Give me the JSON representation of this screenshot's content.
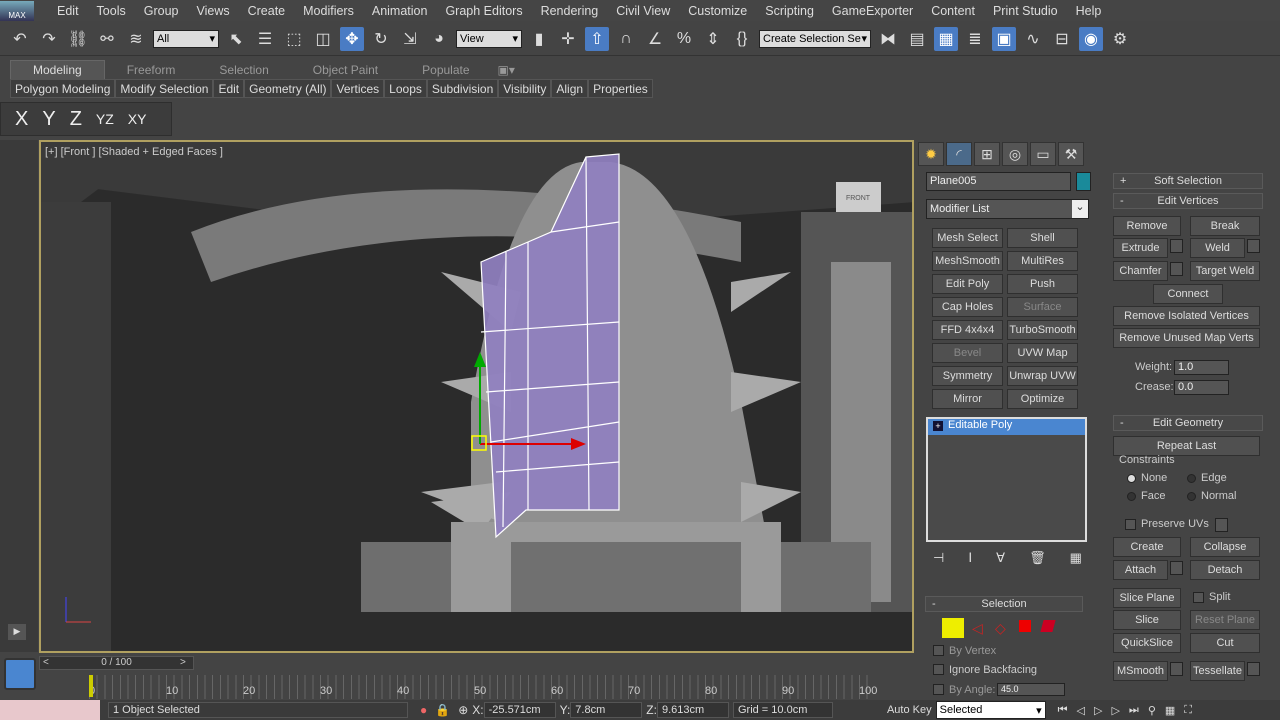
{
  "menubar": {
    "logo": "MAX",
    "items": [
      "Edit",
      "Tools",
      "Group",
      "Views",
      "Create",
      "Modifiers",
      "Animation",
      "Graph Editors",
      "Rendering",
      "Civil View",
      "Customize",
      "Scripting",
      "GameExporter",
      "Content",
      "Print Studio",
      "Help"
    ]
  },
  "toolbar": {
    "selection_filter": "All",
    "reference_coord": "View",
    "named_selection": "Create Selection Se"
  },
  "ribbon": {
    "tabs": [
      "Modeling",
      "Freeform",
      "Selection",
      "Object Paint",
      "Populate"
    ],
    "active_tab": "Modeling",
    "panels": [
      "Polygon Modeling",
      "Modify Selection",
      "Edit",
      "Geometry (All)",
      "Vertices",
      "Loops",
      "Subdivision",
      "Visibility",
      "Align",
      "Properties"
    ]
  },
  "axis_constraints": [
    "X",
    "Y",
    "Z",
    "YZ",
    "XY"
  ],
  "viewport": {
    "label": "[+] [Front ] [Shaded + Edged Faces ]",
    "viewcube": "FRONT"
  },
  "command_panel": {
    "object_name": "Plane005",
    "object_color": "#1a8a9a",
    "modifier_list": "Modifier List",
    "modifier_buttons": [
      [
        "Mesh Select",
        "Shell"
      ],
      [
        "MeshSmooth",
        "MultiRes"
      ],
      [
        "Edit Poly",
        "Push"
      ],
      [
        "Cap Holes",
        "Surface"
      ],
      [
        "FFD 4x4x4",
        "TurboSmooth"
      ],
      [
        "Bevel",
        "UVW Map"
      ],
      [
        "Symmetry",
        "Unwrap UVW"
      ],
      [
        "Mirror",
        "Optimize"
      ]
    ],
    "stack": [
      "Editable Poly"
    ],
    "selection": {
      "title": "Selection",
      "by_vertex": "By Vertex",
      "ignore_backfacing": "Ignore Backfacing",
      "by_angle": "By Angle:",
      "angle": "45.0"
    },
    "soft_selection": "Soft Selection",
    "edit_vertices": {
      "title": "Edit Vertices",
      "remove": "Remove",
      "break": "Break",
      "extrude": "Extrude",
      "weld": "Weld",
      "chamfer": "Chamfer",
      "target_weld": "Target Weld",
      "connect": "Connect",
      "remove_isolated": "Remove Isolated Vertices",
      "remove_unused": "Remove Unused Map Verts",
      "weight_label": "Weight:",
      "weight": "1.0",
      "crease_label": "Crease:",
      "crease": "0.0"
    },
    "edit_geometry": {
      "title": "Edit Geometry",
      "repeat_last": "Repeat Last",
      "constraints": "Constraints",
      "none": "None",
      "edge": "Edge",
      "face": "Face",
      "normal": "Normal",
      "preserve_uvs": "Preserve UVs",
      "create": "Create",
      "collapse": "Collapse",
      "attach": "Attach",
      "detach": "Detach",
      "slice_plane": "Slice Plane",
      "split": "Split",
      "slice": "Slice",
      "reset_plane": "Reset Plane",
      "quickslice": "QuickSlice",
      "cut": "Cut",
      "msmooth": "MSmooth",
      "tessellate": "Tessellate"
    }
  },
  "timeline": {
    "frame": "0 / 100",
    "ticks": [
      "0",
      "10",
      "20",
      "30",
      "40",
      "50",
      "60",
      "70",
      "80",
      "90",
      "100"
    ]
  },
  "status": {
    "selected": "1 Object Selected",
    "x_label": "X:",
    "x": "-25.571cm",
    "y_label": "Y:",
    "y": "7.8cm",
    "z_label": "Z:",
    "z": "9.613cm",
    "grid": "Grid = 10.0cm",
    "auto_key": "Auto Key",
    "key_mode": "Selected"
  }
}
